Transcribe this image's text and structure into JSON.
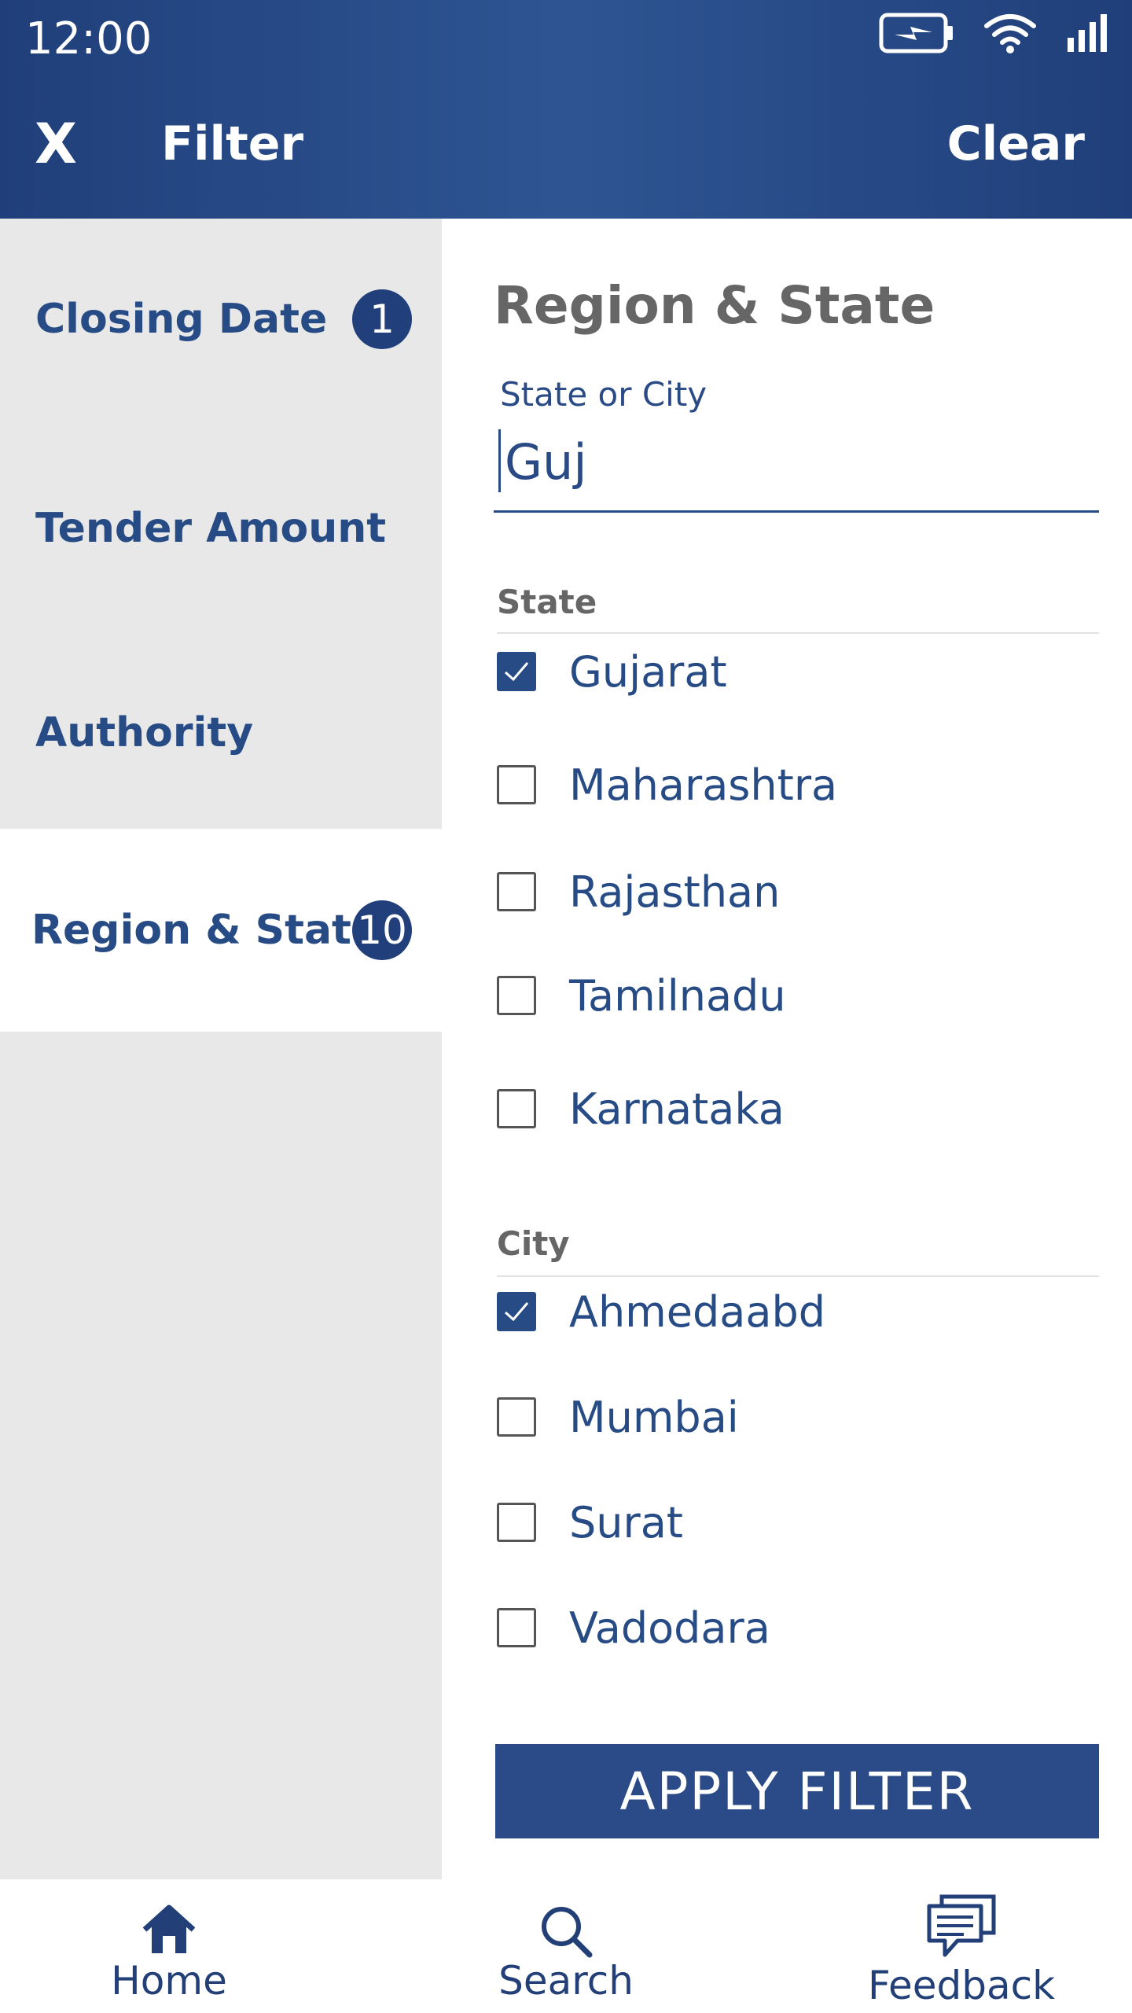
{
  "status_bar": {
    "time": "12:00",
    "icons": [
      "battery-charging-icon",
      "wifi-icon",
      "signal-icon"
    ]
  },
  "header": {
    "close_label": "X",
    "title": "Filter",
    "clear_label": "Clear"
  },
  "sidebar": {
    "items": [
      {
        "label": "Closing Date",
        "badge": "1",
        "active": false
      },
      {
        "label": "Tender Amount",
        "badge": "",
        "active": false
      },
      {
        "label": "Authority",
        "badge": "",
        "active": false
      },
      {
        "label": "Region & State",
        "badge": "10",
        "active": true
      }
    ]
  },
  "panel": {
    "title": "Region & State",
    "search": {
      "label": "State or City",
      "value": "Guj"
    },
    "state_section": {
      "label": "State",
      "options": [
        {
          "label": "Gujarat",
          "checked": true
        },
        {
          "label": "Maharashtra",
          "checked": false
        },
        {
          "label": "Rajasthan",
          "checked": false
        },
        {
          "label": "Tamilnadu",
          "checked": false
        },
        {
          "label": "Karnataka",
          "checked": false
        }
      ]
    },
    "city_section": {
      "label": "City",
      "options": [
        {
          "label": "Ahmedaabd",
          "checked": true
        },
        {
          "label": "Mumbai",
          "checked": false
        },
        {
          "label": "Surat",
          "checked": false
        },
        {
          "label": "Vadodara",
          "checked": false
        }
      ]
    },
    "apply_label": "APPLY FILTER"
  },
  "bottom_nav": [
    {
      "label": "Home",
      "icon": "home-icon"
    },
    {
      "label": "Search",
      "icon": "search-icon"
    },
    {
      "label": "Feedback",
      "icon": "feedback-icon"
    }
  ],
  "colors": {
    "header": "#2a4b87",
    "accent": "#274b85",
    "sidebar_bg": "#e8e8e8",
    "heading_gray": "#666666"
  }
}
